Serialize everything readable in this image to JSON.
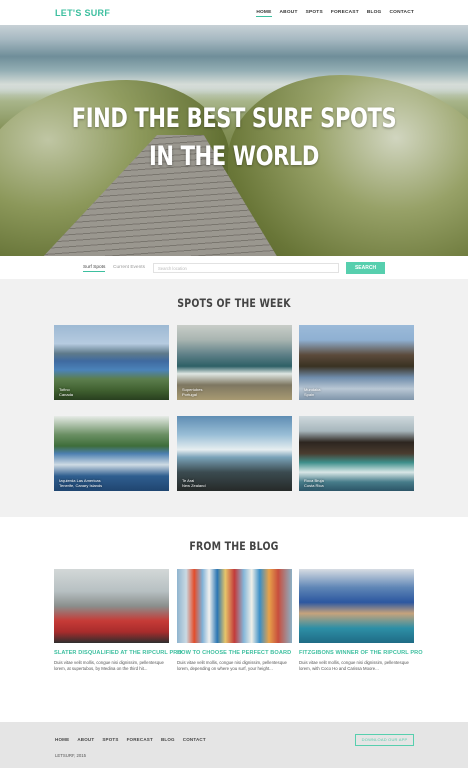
{
  "header": {
    "logo": "LET'S SURF",
    "nav": [
      "HOME",
      "ABOUT",
      "SPOTS",
      "FORECAST",
      "BLOG",
      "CONTACT"
    ]
  },
  "hero": {
    "title_line1": "FIND THE BEST SURF SPOTS",
    "title_line2": "IN THE WORLD"
  },
  "search": {
    "tabs": [
      "Surf Spots",
      "Current Events"
    ],
    "placeholder": "Search location",
    "button": "SEARCH"
  },
  "spots": {
    "title": "SPOTS OF THE WEEK",
    "items": [
      {
        "name": "Tofino",
        "place": "Canada"
      },
      {
        "name": "Supertubes",
        "place": "Portugal"
      },
      {
        "name": "Mundaka",
        "place": "Spain"
      },
      {
        "name": "Izquierda Las Americas",
        "place": "Tenerife, Canary Islands"
      },
      {
        "name": "Te Arai",
        "place": "New Zealand"
      },
      {
        "name": "Roca Bruja",
        "place": "Costa Rica"
      }
    ]
  },
  "blog": {
    "title": "FROM THE BLOG",
    "posts": [
      {
        "title": "SLATER DISQUALIFIED AT THE RIPCURL PRO",
        "excerpt": "Duis vitae velit mollis, congue nisi dignissim, pellentesque lorem, at supertubos, by Medina on the third hit..."
      },
      {
        "title": "HOW TO CHOOSE THE PERFECT BOARD",
        "excerpt": "Duis vitae velit mollis, congue nisi dignissim, pellentesque lorem, depending on where you surf, your height..."
      },
      {
        "title": "FITZGIBONS WINNER OF THE RIPCURL PRO",
        "excerpt": "Duis vitae velit mollis, congue nisi dignissim, pellentesque lorem, with Coco Ho and Carissa Moore..."
      }
    ]
  },
  "footer": {
    "nav": [
      "HOME",
      "ABOUT",
      "SPOTS",
      "FORECAST",
      "BLOG",
      "CONTACT"
    ],
    "copyright": "LETSURF, 2015",
    "download": "DOWNLOAD OUR APP"
  }
}
